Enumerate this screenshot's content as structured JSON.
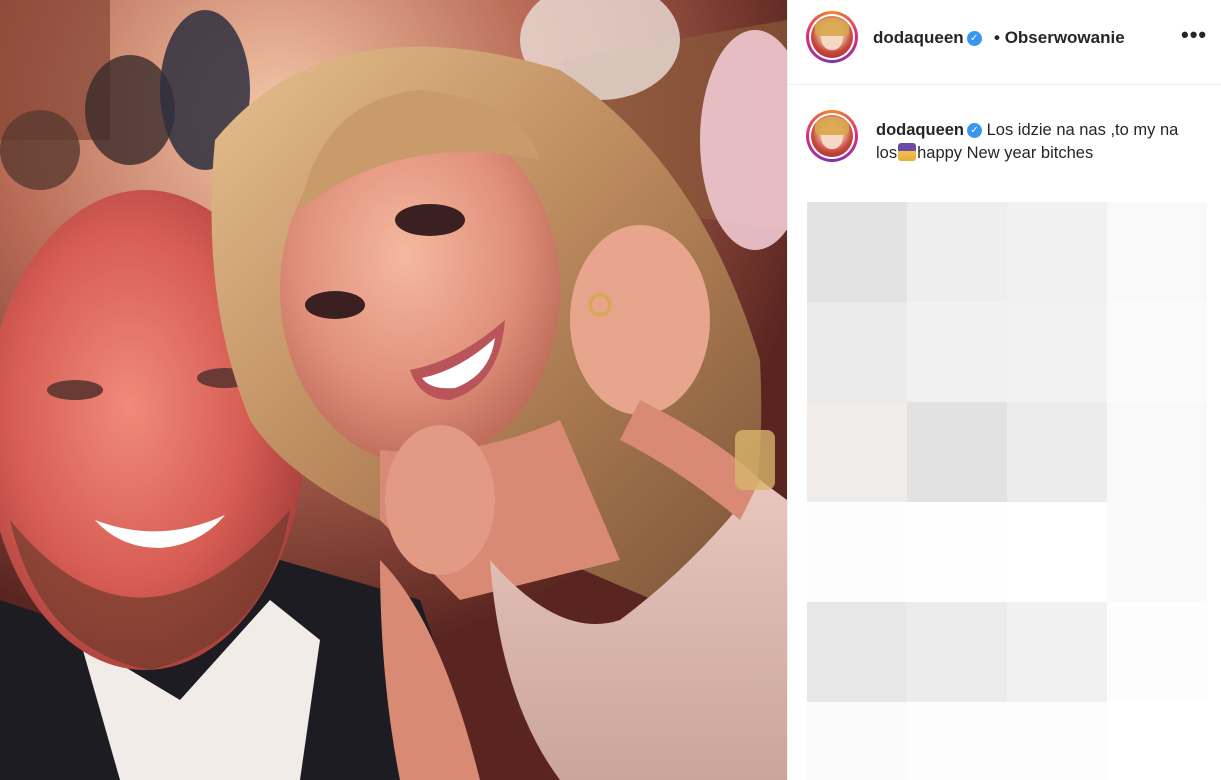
{
  "photo": {
    "alt_description_icon": "selfie-photo"
  },
  "header": {
    "username": "dodaqueen",
    "verified_icon": "verified-badge-icon",
    "separator": "•",
    "follow_label": "Obserwowanie",
    "more_icon": "more-options-icon",
    "more_label": "•••"
  },
  "caption": {
    "username": "dodaqueen",
    "text_before_emoji": "Los idzie na nas ,to my na los",
    "emoji_icon": "woman-mage-emoji",
    "text_after_emoji": "happy New year bitches"
  },
  "colors": {
    "verified": "#3897f0",
    "text": "#262626",
    "divider": "#efefef"
  },
  "blurred_cells": [
    "#e3e3e3",
    "#eeeeee",
    "#f1f1f1",
    "#f9f9f9",
    "#ebebeb",
    "#f1f1f1",
    "#f2f2f2",
    "#fbfbfb",
    "#efecea",
    "#e2e2e2",
    "#ececec",
    "#f9f9f9",
    "#fdfdfd",
    "#fefefe",
    "#ffffff",
    "#fafafa",
    "#e7e7e7",
    "#ececec",
    "#f1f1f1",
    "#fdfdfd",
    "#fbfbfb",
    "#fdfdfd",
    "#fdfdfd",
    "#ffffff"
  ]
}
